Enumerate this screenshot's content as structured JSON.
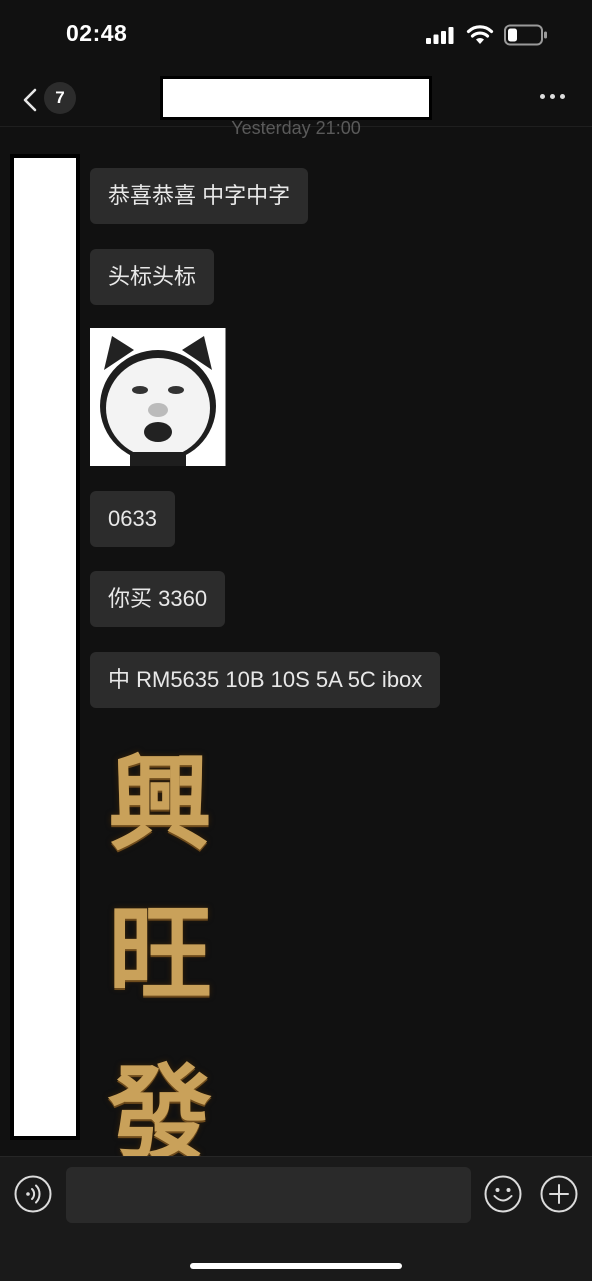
{
  "status_bar": {
    "time": "02:48"
  },
  "nav": {
    "unread_count": "7"
  },
  "chat": {
    "timestamp": "Yesterday 21:00",
    "messages": [
      {
        "type": "text",
        "text": "恭喜恭喜 中字中字"
      },
      {
        "type": "text",
        "text": "头标头标"
      },
      {
        "type": "sticker",
        "description": "meme-face-sticker"
      },
      {
        "type": "text",
        "text": "0633"
      },
      {
        "type": "text",
        "text": "你买 3360"
      },
      {
        "type": "text",
        "text": "中 RM5635 10B 10S 5A 5C  ibox"
      },
      {
        "type": "sticker-text",
        "chars": [
          "興",
          "旺",
          "發"
        ]
      }
    ]
  },
  "input_bar": {
    "icons": [
      "voice-icon",
      "emoji-icon",
      "add-icon"
    ]
  },
  "colors": {
    "background": "#111111",
    "bubble": "#2c2c2c",
    "gold": "#c9a15a"
  }
}
